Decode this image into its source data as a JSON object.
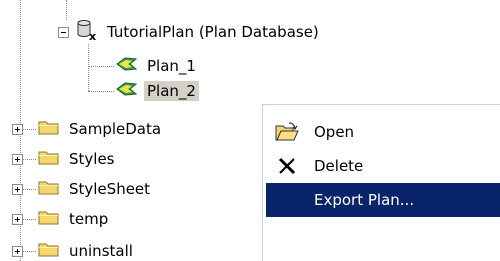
{
  "tree": {
    "database": {
      "label": "TutorialPlan (Plan Database)",
      "icon": "plan-database-icon",
      "expander": "minus"
    },
    "plans": [
      {
        "label": "Plan_1",
        "icon": "plan-icon",
        "selected": false
      },
      {
        "label": "Plan_2",
        "icon": "plan-icon",
        "selected": true
      }
    ],
    "folders": [
      {
        "label": "SampleData",
        "icon": "folder-icon",
        "expander": "plus"
      },
      {
        "label": "Styles",
        "icon": "folder-icon",
        "expander": "plus"
      },
      {
        "label": "StyleSheet",
        "icon": "folder-icon",
        "expander": "plus"
      },
      {
        "label": "temp",
        "icon": "folder-icon",
        "expander": "plus"
      },
      {
        "label": "uninstall",
        "icon": "folder-icon",
        "expander": "plus"
      }
    ]
  },
  "context_menu": {
    "items": [
      {
        "label": "Open",
        "icon": "open-folder-icon",
        "highlighted": false
      },
      {
        "label": "Delete",
        "icon": "delete-x-icon",
        "highlighted": false
      },
      {
        "label": "Export Plan...",
        "icon": "",
        "highlighted": true
      }
    ]
  },
  "colors": {
    "highlight": "#0a246a",
    "selection": "#d4d0c8",
    "folder": "#f5d76e"
  }
}
